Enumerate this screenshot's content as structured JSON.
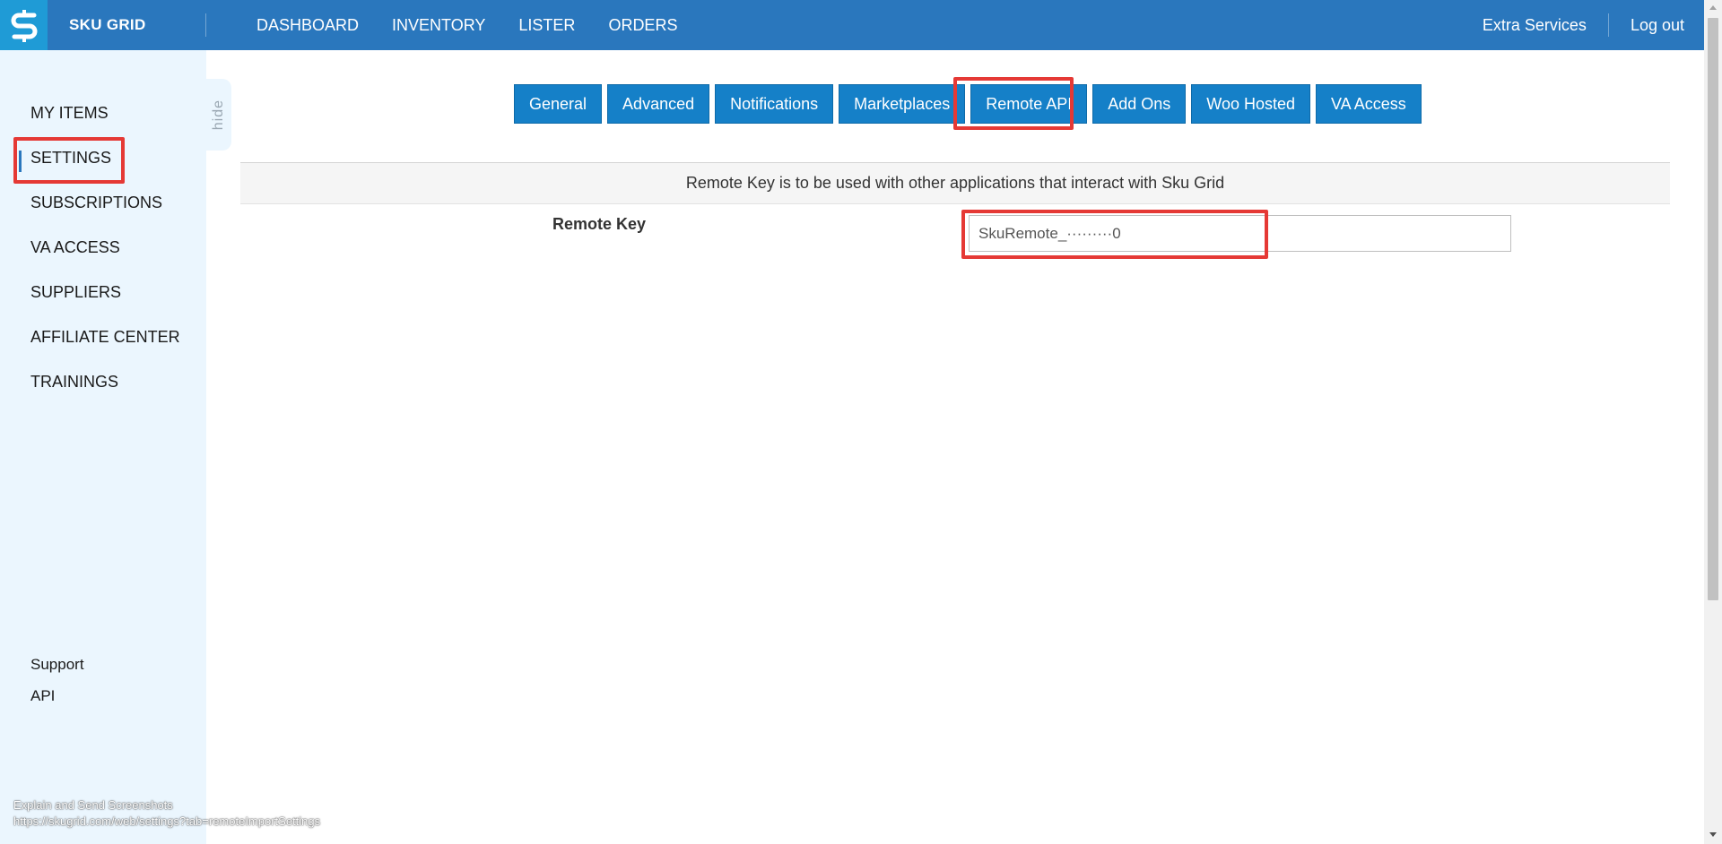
{
  "app": {
    "brand": "SKU GRID"
  },
  "topnav": {
    "items": [
      "DASHBOARD",
      "INVENTORY",
      "LISTER",
      "ORDERS"
    ],
    "right": [
      "Extra Services",
      "Log out"
    ]
  },
  "sidebar": {
    "items": [
      "MY ITEMS",
      "SETTINGS",
      "SUBSCRIPTIONS",
      "VA ACCESS",
      "SUPPLIERS",
      "AFFILIATE CENTER",
      "TRAININGS"
    ],
    "active": "SETTINGS",
    "bottom": [
      "Support",
      "API"
    ],
    "hide_label": "hide"
  },
  "tabs": {
    "items": [
      "General",
      "Advanced",
      "Notifications",
      "Marketplaces",
      "Remote API",
      "Add Ons",
      "Woo Hosted",
      "VA Access"
    ],
    "active": "Remote API"
  },
  "remote_api": {
    "info": "Remote Key is to be used with other applications that interact with Sku Grid",
    "label": "Remote Key",
    "value": "SkuRemote_·········0"
  },
  "overlay": {
    "line1": "Explain and Send Screenshots",
    "line2": "https://skugrid.com/web/settings?tab=remoteImportSettings"
  },
  "colors": {
    "topbar": "#2a77bd",
    "logo_bg": "#1f9bd6",
    "sidebar_bg": "#ebf6fe",
    "tab_bg": "#1580c8",
    "highlight": "#e53935"
  }
}
